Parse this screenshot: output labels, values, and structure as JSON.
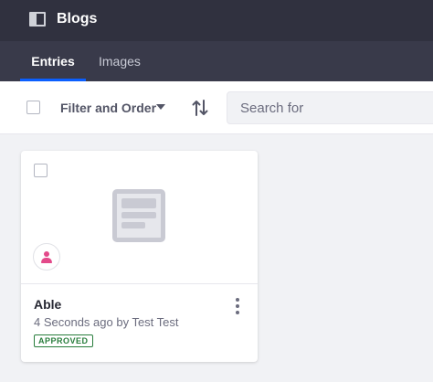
{
  "header": {
    "title": "Blogs",
    "panel_icon": "panel-toggle-icon"
  },
  "nav": {
    "tabs": [
      {
        "label": "Entries",
        "active": true
      },
      {
        "label": "Images",
        "active": false
      }
    ]
  },
  "toolbar": {
    "filter_label": "Filter and Order",
    "search_placeholder": "Search for"
  },
  "cards": [
    {
      "title": "Able",
      "subtitle": "4 Seconds ago by Test Test",
      "status": "APPROVED",
      "status_color": "#287d3c"
    }
  ],
  "colors": {
    "header_bg": "#30313f",
    "nav_bg": "#393a4a",
    "accent": "#0b5fff",
    "avatar": "#e34a8a"
  }
}
